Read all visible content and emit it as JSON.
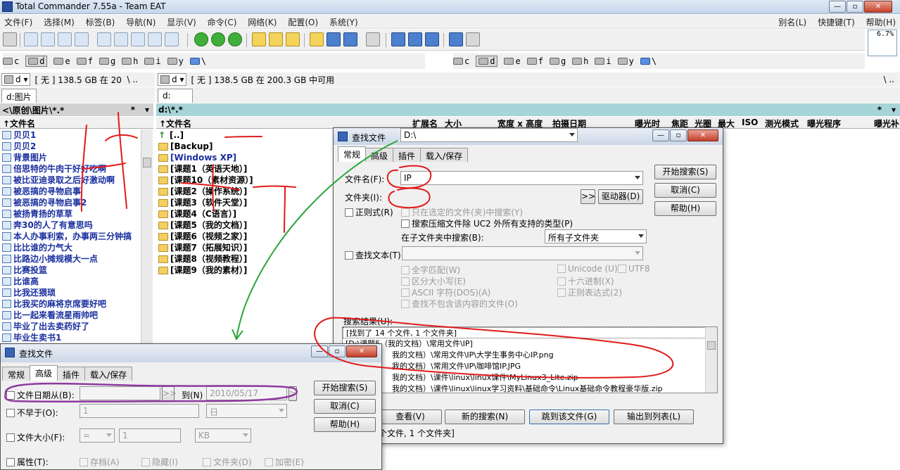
{
  "window": {
    "title": "Total Commander 7.55a - Team EAT"
  },
  "menu": {
    "items": [
      "文件(F)",
      "选择(M)",
      "标签(B)",
      "导航(N)",
      "显示(V)",
      "命令(C)",
      "网络(K)",
      "配置(O)",
      "系统(Y)"
    ],
    "right": [
      "别名(L)",
      "快捷键(T)",
      "帮助(H)"
    ]
  },
  "cpu_meter": "6.7%",
  "left": {
    "drives": [
      "c",
      "d",
      "e",
      "f",
      "g",
      "h",
      "i",
      "y",
      "\\"
    ],
    "selected_drive": "d",
    "drive_combo": "d",
    "info": "[ 无 ]  138.5 GB 在 20",
    "info_tail": "\\  ..",
    "tab": "d:图片",
    "path": "<\\原创\\图片\\*.*",
    "path_star": "*",
    "col_name": "↑文件名",
    "files": [
      "贝贝1",
      "贝贝2",
      "背景图片",
      "倍思特的牛肉干好好吃啊",
      "被比亚迪录取之后好激动啊",
      "被恶搞的寻物启事",
      "被恶搞的寻物启事2",
      "被扬青扬的草草",
      "奔30的人了有意思吗",
      "本人办事利索，办事两三分钟搞",
      "比比谁的力气大",
      "比路边小摊规模大一点",
      "比赛投篮",
      "比谁高",
      "比我还猥琐",
      "比我买的麻将京席要好吧",
      "比一起来看流星雨帅吧",
      "毕业了出去卖药好了",
      "毕业生卖书1"
    ]
  },
  "right": {
    "drives": [
      "c",
      "d",
      "e",
      "f",
      "g",
      "h",
      "i",
      "y",
      "\\"
    ],
    "selected_drive": "d",
    "drive_combo": "d",
    "info": "[ 无 ]  138.5 GB 在 200.3 GB 中可用",
    "info_tail": "\\  ..",
    "tab": "d:",
    "path": "d:\\*.*",
    "path_star": "*",
    "columns": [
      "↑文件名",
      "扩展名",
      "大小",
      "宽度 x 高度",
      "拍摄日期",
      "曝光时",
      "焦距",
      "光圈",
      "最大",
      "ISO",
      "测光模式",
      "曝光程序",
      "曝光补"
    ],
    "items": [
      {
        "name": "[..]",
        "type": "up"
      },
      {
        "name": "[Backup]",
        "type": "folder"
      },
      {
        "name": "[Windows XP]",
        "type": "folder"
      },
      {
        "name": "[课题1（英语天地）]",
        "type": "folder"
      },
      {
        "name": "[课题10（素材资源）]",
        "type": "folder"
      },
      {
        "name": "[课题2（操作系统）]",
        "type": "folder"
      },
      {
        "name": "[课题3（软件天堂）]",
        "type": "folder"
      },
      {
        "name": "[课题4（C语言）]",
        "type": "folder"
      },
      {
        "name": "[课题5（我的文档）]",
        "type": "folder"
      },
      {
        "name": "[课题6（视频之家）]",
        "type": "folder"
      },
      {
        "name": "[课题7（拓展知识）]",
        "type": "folder"
      },
      {
        "name": "[课题8（视频教程）]",
        "type": "folder"
      },
      {
        "name": "[课题9（我的素材）]",
        "type": "folder"
      }
    ]
  },
  "find_dialog": {
    "title": "查找文件",
    "tabs": [
      "常规",
      "高级",
      "插件",
      "载入/保存"
    ],
    "filename_label": "文件名(F):",
    "filename_value": "IP",
    "folder_label": "文件夹(I):",
    "folder_value": "D:\\",
    "browse_label": ">>",
    "drives_label": "驱动器(D)",
    "regex_label": "正则式(R)",
    "only_selected_label": "只在选定的文件(夹)中搜索(Y)",
    "search_archives_label": "搜索压缩文件除 UC2 外所有支持的类型(P)",
    "subfolder_label": "在子文件夹中搜索(B):",
    "subfolder_value": "所有子文件夹",
    "find_text_label": "查找文本(T):",
    "opt_whole_words": "全字匹配(W)",
    "opt_case": "区分大小写(E)",
    "opt_ascii": "ASCII 字符(DOS)(A)",
    "opt_not_contain": "查找不包含该内容的文件(O)",
    "opt_unicode": "Unicode (U)",
    "opt_utf8": "UTF8",
    "opt_hex": "十六进制(X)",
    "opt_regex2": "正则表达式(2)",
    "btn_start": "开始搜索(S)",
    "btn_cancel": "取消(C)",
    "btn_help": "帮助(H)",
    "results_label": "搜索结果(U):",
    "results": [
      "[找到了 14 个文件, 1 个文件夹]",
      "[D:\\课题5（我的文档）\\常用文件\\IP]",
      "我的文档）\\常用文件\\IP\\大学生事务中心IP.png",
      "我的文档）\\常用文件\\IP\\咖啡馆IP.JPG",
      "我的文档）\\课件\\linux\\linux课件\\MyLinux3_Lite.zip",
      "我的文档）\\课件\\linux\\linux学习资料\\基础命令\\Linux基础命令教程豪华版.zip"
    ],
    "btn_view": "查看(V)",
    "btn_new": "新的搜索(N)",
    "btn_goto": "跳到该文件(G)",
    "btn_feed": "输出到列表(L)",
    "status": "个文件, 1 个文件夹]"
  },
  "adv_dialog": {
    "title": "查找文件",
    "tabs": [
      "常规",
      "高级",
      "插件",
      "载入/保存"
    ],
    "date_from_label": "文件日期从(B):",
    "date_from_value": "",
    "to_label": "到(N)",
    "date_to_value": "2010/05/17",
    "not_older_label": "不早于(O):",
    "not_older_value": "1",
    "not_older_unit": "日",
    "size_label": "文件大小(F):",
    "size_op": "=",
    "size_value": "1",
    "size_unit": "KB",
    "attr_label": "属性(T):",
    "attr_archive": "存档(A)",
    "attr_hidden": "隐藏(I)",
    "attr_folder": "文件夹(D)",
    "attr_encrypt": "加密(E)",
    "btn_start": "开始搜索(S)",
    "btn_cancel": "取消(C)",
    "btn_help": "帮助(H)"
  },
  "colors": {
    "active_path": "#a6d4d8",
    "list_text": "#1a2f9e",
    "annot_red": "#e21a1a",
    "annot_green": "#2aa63a",
    "annot_purple": "#8e3a9e"
  }
}
